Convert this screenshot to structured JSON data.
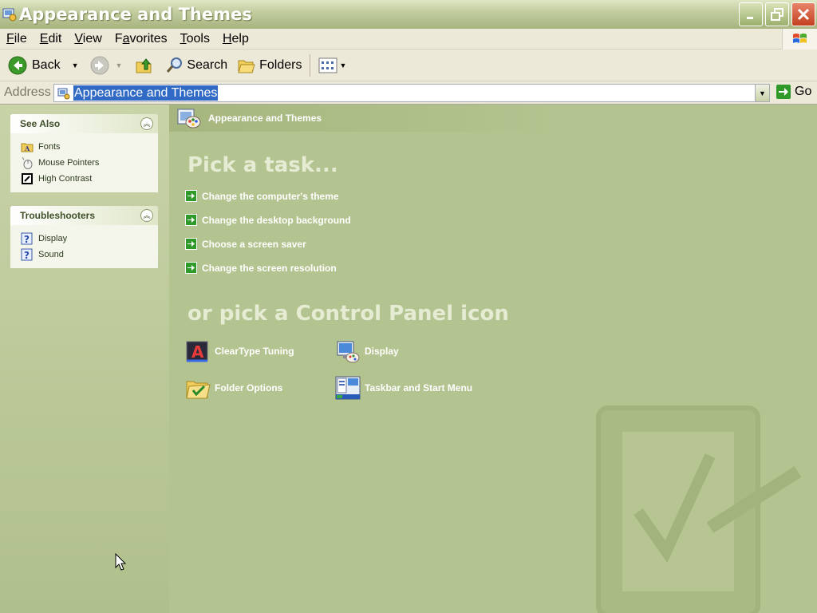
{
  "window": {
    "title": "Appearance and Themes"
  },
  "menu": {
    "items": [
      {
        "label": "File",
        "accel": "F",
        "rest": "ile"
      },
      {
        "label": "Edit",
        "accel": "E",
        "rest": "dit"
      },
      {
        "label": "View",
        "accel": "V",
        "rest": "iew"
      },
      {
        "label": "Favorites",
        "accel": "a",
        "pre": "F",
        "rest": "vorites"
      },
      {
        "label": "Tools",
        "accel": "T",
        "rest": "ools"
      },
      {
        "label": "Help",
        "accel": "H",
        "rest": "elp"
      }
    ]
  },
  "toolbar": {
    "back_label": "Back",
    "search_label": "Search",
    "folders_label": "Folders"
  },
  "address": {
    "label": "Address",
    "value": "Appearance and Themes",
    "go_label": "Go"
  },
  "see_also": {
    "title": "See Also",
    "items": [
      {
        "label": "Fonts",
        "icon": "fonts-folder-icon"
      },
      {
        "label": "Mouse Pointers",
        "icon": "mouse-icon"
      },
      {
        "label": "High Contrast",
        "icon": "high-contrast-icon"
      }
    ]
  },
  "troubleshooters": {
    "title": "Troubleshooters",
    "items": [
      {
        "label": "Display",
        "icon": "help-icon"
      },
      {
        "label": "Sound",
        "icon": "help-icon"
      }
    ]
  },
  "main": {
    "header_title": "Appearance and Themes",
    "pick_task_title": "Pick a task...",
    "tasks": [
      "Change the computer's theme",
      "Change the desktop background",
      "Choose a screen saver",
      "Change the screen resolution"
    ],
    "pick_icon_title": "or pick a Control Panel icon",
    "icons": [
      {
        "label": "ClearType Tuning",
        "icon": "cleartype-icon"
      },
      {
        "label": "Display",
        "icon": "display-icon"
      },
      {
        "label": "Folder Options",
        "icon": "folder-options-icon"
      },
      {
        "label": "Taskbar and Start Menu",
        "icon": "taskbar-icon"
      }
    ]
  },
  "colors": {
    "content_bg": "#b4c490",
    "task_arrow": "#2f9a2a",
    "section_title": "#e6ecd4"
  }
}
